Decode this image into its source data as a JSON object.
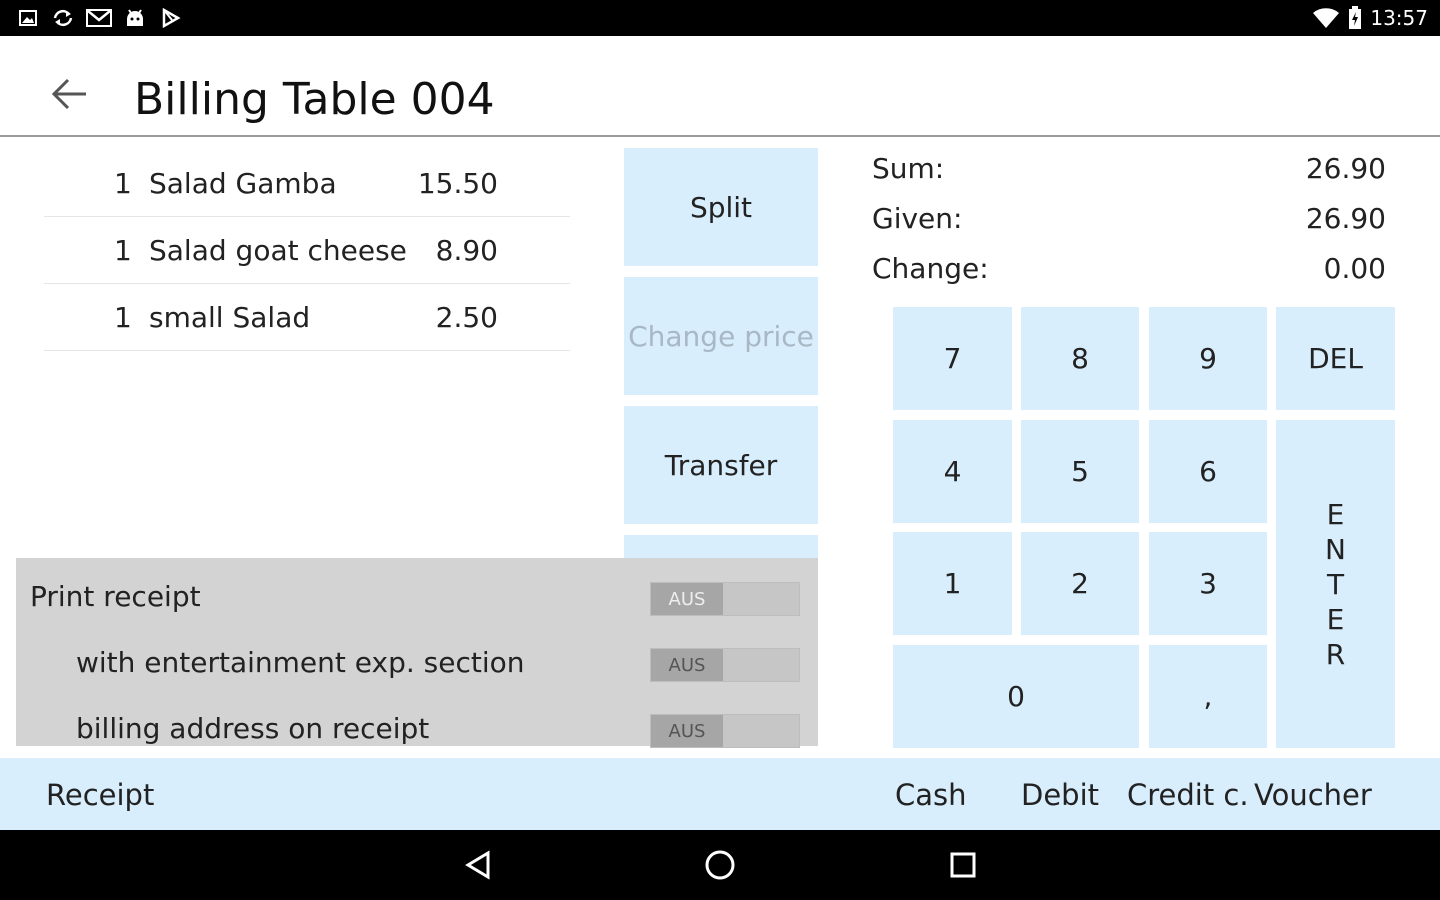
{
  "status_bar": {
    "time": "13:57",
    "left_icons": [
      "gallery-icon",
      "sync-icon",
      "gmail-icon",
      "android-icon",
      "play-store-icon"
    ],
    "right_icons": [
      "wifi-icon",
      "battery-icon"
    ]
  },
  "header": {
    "title": "Billing Table 004",
    "back_icon": "arrow-left-icon"
  },
  "order_items": [
    {
      "qty": "1",
      "name": "Salad Gamba",
      "price": "15.50"
    },
    {
      "qty": "1",
      "name": "Salad goat cheese",
      "price": "8.90"
    },
    {
      "qty": "1",
      "name": "small Salad",
      "price": "2.50"
    }
  ],
  "actions": {
    "split": "Split",
    "change_price": "Change price",
    "transfer": "Transfer"
  },
  "print_options": {
    "print_receipt": {
      "label": "Print receipt",
      "state": "AUS"
    },
    "entertainment": {
      "label": "with entertainment exp. section",
      "state": "AUS"
    },
    "billing_address": {
      "label": "billing address on receipt",
      "state": "AUS"
    }
  },
  "totals": {
    "sum_label": "Sum:",
    "sum_value": "26.90",
    "given_label": "Given:",
    "given_value": "26.90",
    "change_label": "Change:",
    "change_value": "0.00"
  },
  "keypad": {
    "k7": "7",
    "k8": "8",
    "k9": "9",
    "del": "DEL",
    "k4": "4",
    "k5": "5",
    "k6": "6",
    "k1": "1",
    "k2": "2",
    "k3": "3",
    "k0": "0",
    "comma": ",",
    "enter_letters": [
      "E",
      "N",
      "T",
      "E",
      "R"
    ]
  },
  "payment_bar": {
    "receipt": "Receipt",
    "cash": "Cash",
    "debit": "Debit",
    "credit": "Credit c.",
    "voucher": "Voucher"
  },
  "colors": {
    "accent_light_blue": "#d8eefc",
    "panel_gray": "#d3d3d3",
    "disabled_text": "#a8b8c4"
  }
}
